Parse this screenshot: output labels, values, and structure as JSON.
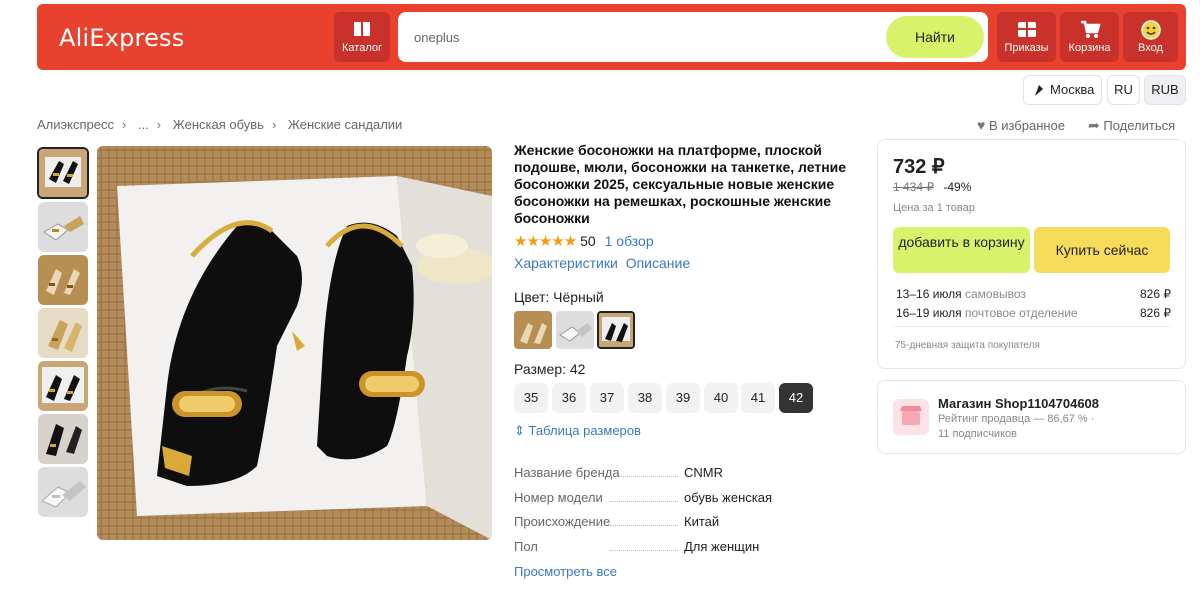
{
  "header": {
    "logo": "AliExpress",
    "catalog": "Каталог",
    "search_value": "oneplus",
    "search_button": "Найти",
    "orders": "Приказы",
    "cart": "Корзина",
    "login": "Вход"
  },
  "locale": {
    "city": "Москва",
    "lang": "RU",
    "currency": "RUB"
  },
  "breadcrumbs": [
    "Алиэкспресс",
    "...",
    "Женская обувь",
    "Женские сандалии"
  ],
  "actions": {
    "favorite": "В избранное",
    "share": "Поделиться"
  },
  "product": {
    "title": "Женские босоножки на платформе, плоской подошве, мюли, босоножки на танкетке, летние босоножки 2025, сексуальные новые женские босоножки на ремешках, роскошные женские босоножки",
    "stars": "★★★★★",
    "rating": "50",
    "reviews": "1 обзор",
    "tab_specs": "Характеристики",
    "tab_desc": "Описание",
    "color_label": "Цвет: Чёрный",
    "size_label": "Размер: 42",
    "sizes": [
      "35",
      "36",
      "37",
      "38",
      "39",
      "40",
      "41",
      "42"
    ],
    "size_table": "Таблица размеров",
    "specs": [
      {
        "name": "Название бренда",
        "value": "CNMR"
      },
      {
        "name": "Номер модели",
        "value": "обувь женская"
      },
      {
        "name": "Происхождение",
        "value": "Китай"
      },
      {
        "name": "Пол",
        "value": "Для женщин"
      }
    ],
    "see_all": "Просмотреть все"
  },
  "buy": {
    "price": "732 ₽",
    "old_price": "1 434 ₽",
    "discount": "-49%",
    "unit_note": "Цена за 1 товар",
    "add_to_cart": "добавить в корзину",
    "buy_now": "Купить сейчас",
    "delivery": [
      {
        "date": "13–16 июля",
        "method": "самовывоз",
        "price": "826 ₽"
      },
      {
        "date": "16–19 июля",
        "method": "почтовое отделение",
        "price": "826 ₽"
      }
    ],
    "protection": "75-дневная защита покупателя"
  },
  "shop": {
    "name": "Магазин Shop1104704608",
    "rating": "Рейтинг продавца — 86,67 % ·",
    "followers": "11 подписчиков"
  },
  "colors": {
    "accent": "#e8412e",
    "cart_btn": "#d8f26b",
    "buy_btn": "#f7dc5c",
    "link": "#3a78c3"
  }
}
